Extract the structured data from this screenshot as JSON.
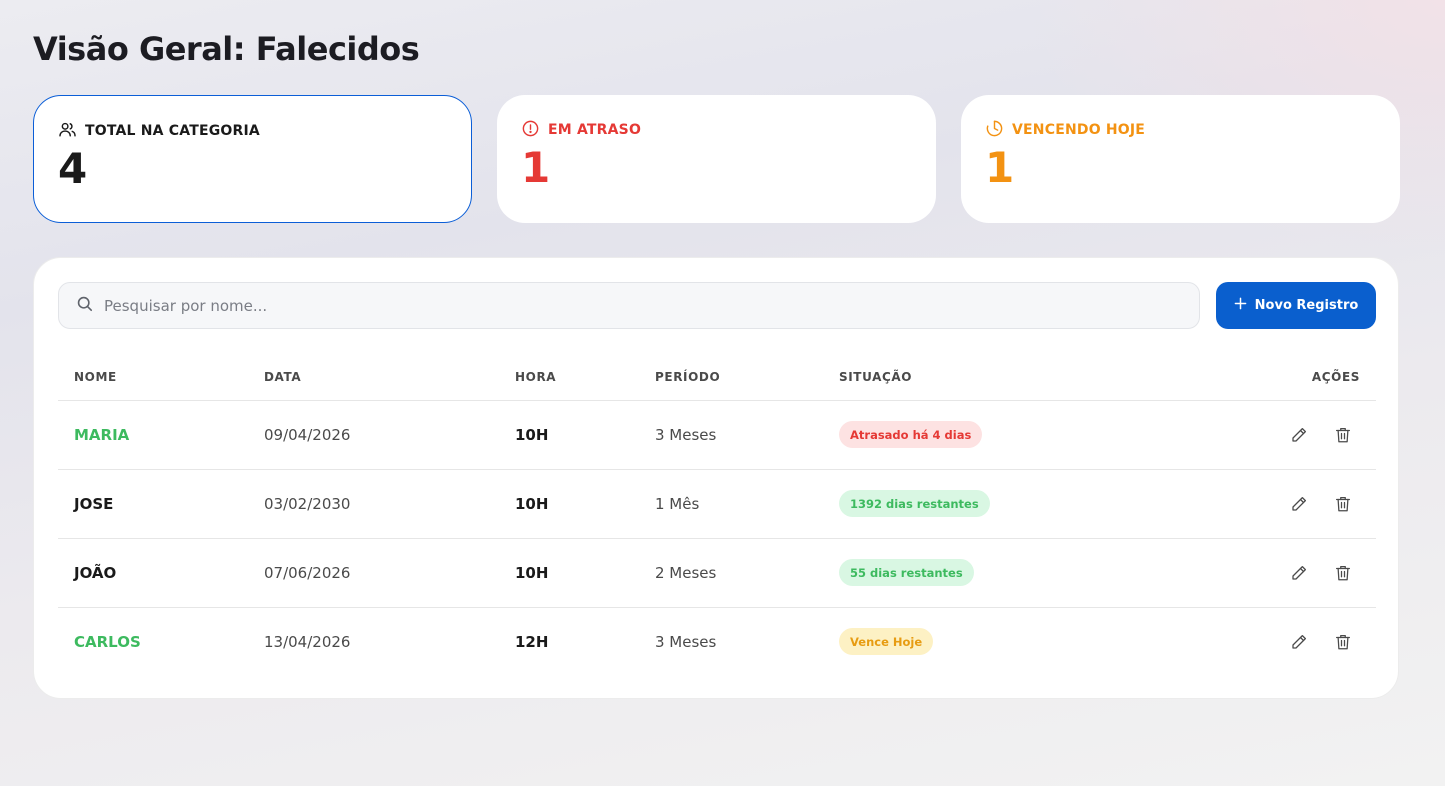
{
  "page": {
    "title": "Visão Geral: Falecidos"
  },
  "cards": [
    {
      "label": "TOTAL NA CATEGORIA",
      "value": "4",
      "icon": "users-icon",
      "color": "#1a1a1a"
    },
    {
      "label": "EM ATRASO",
      "value": "1",
      "icon": "alert-circle-icon",
      "color": "#e53935"
    },
    {
      "label": "VENCENDO HOJE",
      "value": "1",
      "icon": "clock-icon",
      "color": "#f39212"
    }
  ],
  "search": {
    "placeholder": "Pesquisar por nome...",
    "value": ""
  },
  "toolbar": {
    "new_label": "Novo Registro",
    "accent": "#0a5fce"
  },
  "table": {
    "headers": [
      "NOME",
      "DATA",
      "HORA",
      "PERÍODO",
      "SITUAÇÃO",
      "AÇÕES"
    ],
    "rows": [
      {
        "nome": "MARIA",
        "data": "09/04/2026",
        "hora": "10H",
        "periodo": "3 Meses",
        "situacao": "Atrasado há 4 dias",
        "status": "red",
        "name_color": "#3dba5f"
      },
      {
        "nome": "JOSE",
        "data": "03/02/2030",
        "hora": "10H",
        "periodo": "1 Mês",
        "situacao": "1392 dias restantes",
        "status": "green",
        "name_color": "#1a1a1a"
      },
      {
        "nome": "JOÃO",
        "data": "07/06/2026",
        "hora": "10H",
        "periodo": "2 Meses",
        "situacao": "55 dias restantes",
        "status": "green",
        "name_color": "#1a1a1a"
      },
      {
        "nome": "CARLOS",
        "data": "13/04/2026",
        "hora": "12H",
        "periodo": "3 Meses",
        "situacao": "Vence Hoje",
        "status": "yellow",
        "name_color": "#3dba5f"
      }
    ]
  }
}
